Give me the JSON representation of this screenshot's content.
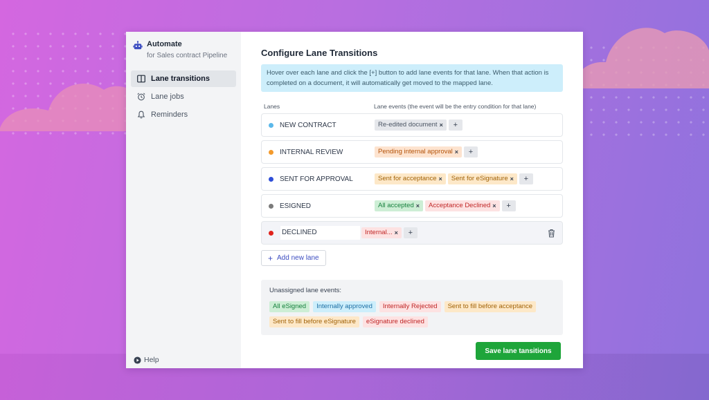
{
  "sidebar": {
    "brand_title": "Automate",
    "brand_subtitle": "for Sales contract Pipeline",
    "items": [
      {
        "label": "Lane transitions",
        "icon": "columns-icon",
        "active": true
      },
      {
        "label": "Lane jobs",
        "icon": "alarm-clock-icon",
        "active": false
      },
      {
        "label": "Reminders",
        "icon": "bell-icon",
        "active": false
      }
    ],
    "help_label": "Help"
  },
  "main": {
    "title": "Configure Lane Transitions",
    "info": "Hover over each lane and click the [+] button to add lane events for that lane. When that action is completed on a document, it will automatically get moved to the mapped lane.",
    "col_lanes": "Lanes",
    "col_events": "Lane events (the event will be the entry condition for that lane)",
    "lanes": [
      {
        "name": "NEW CONTRACT",
        "dot_color": "#5bb8ea",
        "events": [
          {
            "label": "Re-edited document",
            "bg": "#e5e7eb",
            "fg": "#4b5563"
          }
        ]
      },
      {
        "name": "INTERNAL REVIEW",
        "dot_color": "#f39a2c",
        "events": [
          {
            "label": "Pending internal approval",
            "bg": "#fde3cf",
            "fg": "#b45309"
          }
        ]
      },
      {
        "name": "SENT FOR APPROVAL",
        "dot_color": "#2f4fd8",
        "events": [
          {
            "label": "Sent for acceptance",
            "bg": "#fde8c8",
            "fg": "#a16207"
          },
          {
            "label": "Sent for eSignature",
            "bg": "#fde8c8",
            "fg": "#a16207"
          }
        ]
      },
      {
        "name": "ESIGNED",
        "dot_color": "#7b7b7b",
        "events": [
          {
            "label": "All accepted",
            "bg": "#cdeed5",
            "fg": "#15803d"
          },
          {
            "label": "Acceptance Declined",
            "bg": "#fde2e2",
            "fg": "#c02626"
          }
        ]
      },
      {
        "name": "DECLINED",
        "dot_color": "#e0231c",
        "editing": true,
        "events": [
          {
            "label": "Internal...",
            "bg": "#fde2e2",
            "fg": "#c02626"
          }
        ]
      }
    ],
    "add_lane_label": "Add new lane",
    "unassigned_title": "Unassigned lane events:",
    "unassigned": [
      {
        "label": "All eSigned",
        "bg": "#cdeed5",
        "fg": "#15803d"
      },
      {
        "label": "Internally approved",
        "bg": "#cdeefb",
        "fg": "#1d6fa5"
      },
      {
        "label": "Internally Rejected",
        "bg": "#fde2e2",
        "fg": "#c02626"
      },
      {
        "label": "Sent to fill before acceptance",
        "bg": "#fde8c8",
        "fg": "#a16207"
      },
      {
        "label": "Sent to fill before eSignature",
        "bg": "#fde8c8",
        "fg": "#a16207"
      },
      {
        "label": "eSignature declined",
        "bg": "#fde2e2",
        "fg": "#c02626"
      }
    ],
    "save_label": "Save lane tansitions"
  }
}
